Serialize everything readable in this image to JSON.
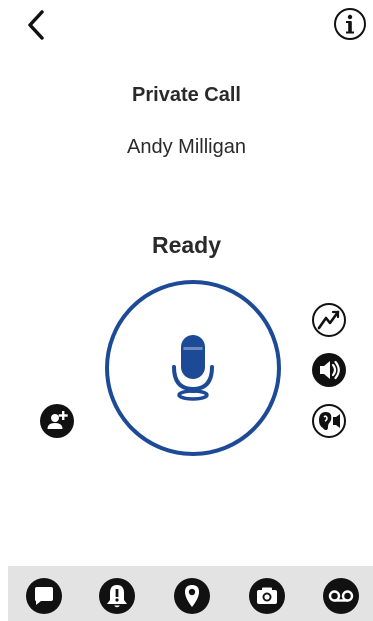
{
  "header": {
    "back_icon": "chevron-left-icon",
    "info_icon": "info-circle-icon"
  },
  "call": {
    "type": "Private Call",
    "contact": "Andy Milligan",
    "status": "Ready"
  },
  "colors": {
    "accent": "#1c4a96",
    "icon_dark": "#111111",
    "bottom_bar": "#e3e3e3"
  },
  "side_controls": [
    {
      "icon": "add-person-icon"
    },
    {
      "icon": "network-signal-icon"
    },
    {
      "icon": "speaker-icon"
    },
    {
      "icon": "earpiece-icon"
    }
  ],
  "bottom_nav": [
    {
      "icon": "chat-bubble-icon"
    },
    {
      "icon": "alert-bell-icon"
    },
    {
      "icon": "location-pin-icon"
    },
    {
      "icon": "camera-icon"
    },
    {
      "icon": "voicemail-icon"
    }
  ]
}
